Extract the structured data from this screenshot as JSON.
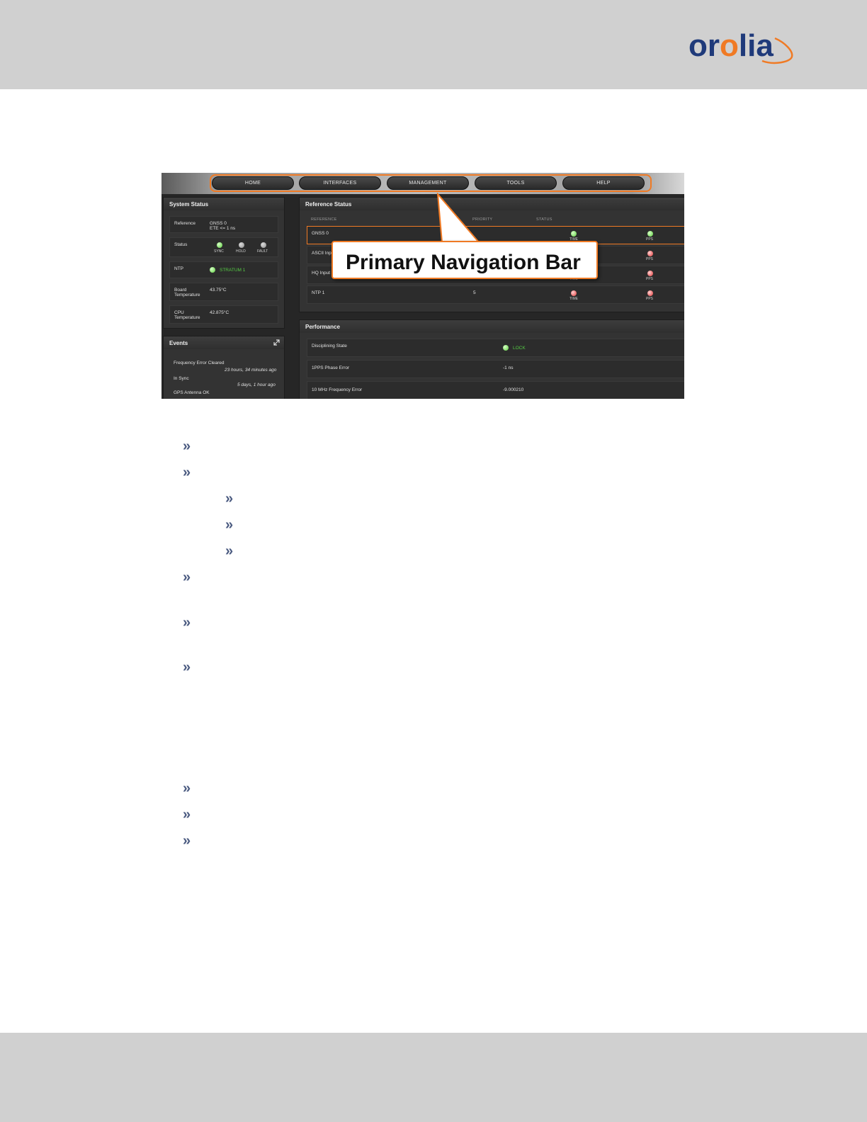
{
  "brand": {
    "logo_text_a": "or",
    "logo_text_o": "o",
    "logo_text_b": "lia"
  },
  "figure": {
    "nav": {
      "items": [
        "HOME",
        "INTERFACES",
        "MANAGEMENT",
        "TOOLS",
        "HELP"
      ]
    },
    "callout_label": "Primary Navigation Bar",
    "system_status": {
      "title": "System Status",
      "reference_label": "Reference",
      "reference_value_1": "GNSS 0",
      "reference_value_2": "ETE <= 1 ns",
      "status_label": "Status",
      "status_indicators": [
        "SYNC",
        "HOLD",
        "FAULT"
      ],
      "ntp_label": "NTP",
      "ntp_value": "STRATUM 1",
      "board_temp_label_1": "Board",
      "board_temp_label_2": "Temperature",
      "board_temp_value": "43.75°C",
      "cpu_temp_label_1": "CPU",
      "cpu_temp_label_2": "Temperature",
      "cpu_temp_value": "42.875°C"
    },
    "events": {
      "title": "Events",
      "items": [
        {
          "text": "Frequency Error Cleared",
          "time": "23 hours, 34 minutes ago"
        },
        {
          "text": "In Sync",
          "time": "5 days, 1 hour ago"
        },
        {
          "text": "GPS Antenna OK",
          "time": ""
        }
      ]
    },
    "reference_status": {
      "title": "Reference Status",
      "col_reference": "REFERENCE",
      "col_priority": "PRIORITY",
      "col_status": "STATUS",
      "rows": [
        {
          "reference": "GNSS 0",
          "priority": "",
          "time_label": "TIME",
          "pps_label": "PPS"
        },
        {
          "reference": "ASCII Inp",
          "priority": "",
          "time_label": "TIME",
          "pps_label": "PPS"
        },
        {
          "reference": "HQ Input",
          "priority": "",
          "time_label": "TIME",
          "pps_label": "PPS"
        },
        {
          "reference": "NTP 1",
          "priority": "5",
          "time_label": "TIME",
          "pps_label": "PPS"
        }
      ]
    },
    "performance": {
      "title": "Performance",
      "rows": [
        {
          "label": "Disciplining State",
          "value": "LOCK"
        },
        {
          "label": "1PPS Phase Error",
          "value": "-1 ns"
        },
        {
          "label": "10 MHz Frequency Error",
          "value": "-9.000210"
        }
      ]
    }
  },
  "colors": {
    "accent": "#f07a24",
    "brand_blue": "#1f3a7a",
    "bullet": "#4a5a80"
  },
  "bullet_glyph": "»"
}
